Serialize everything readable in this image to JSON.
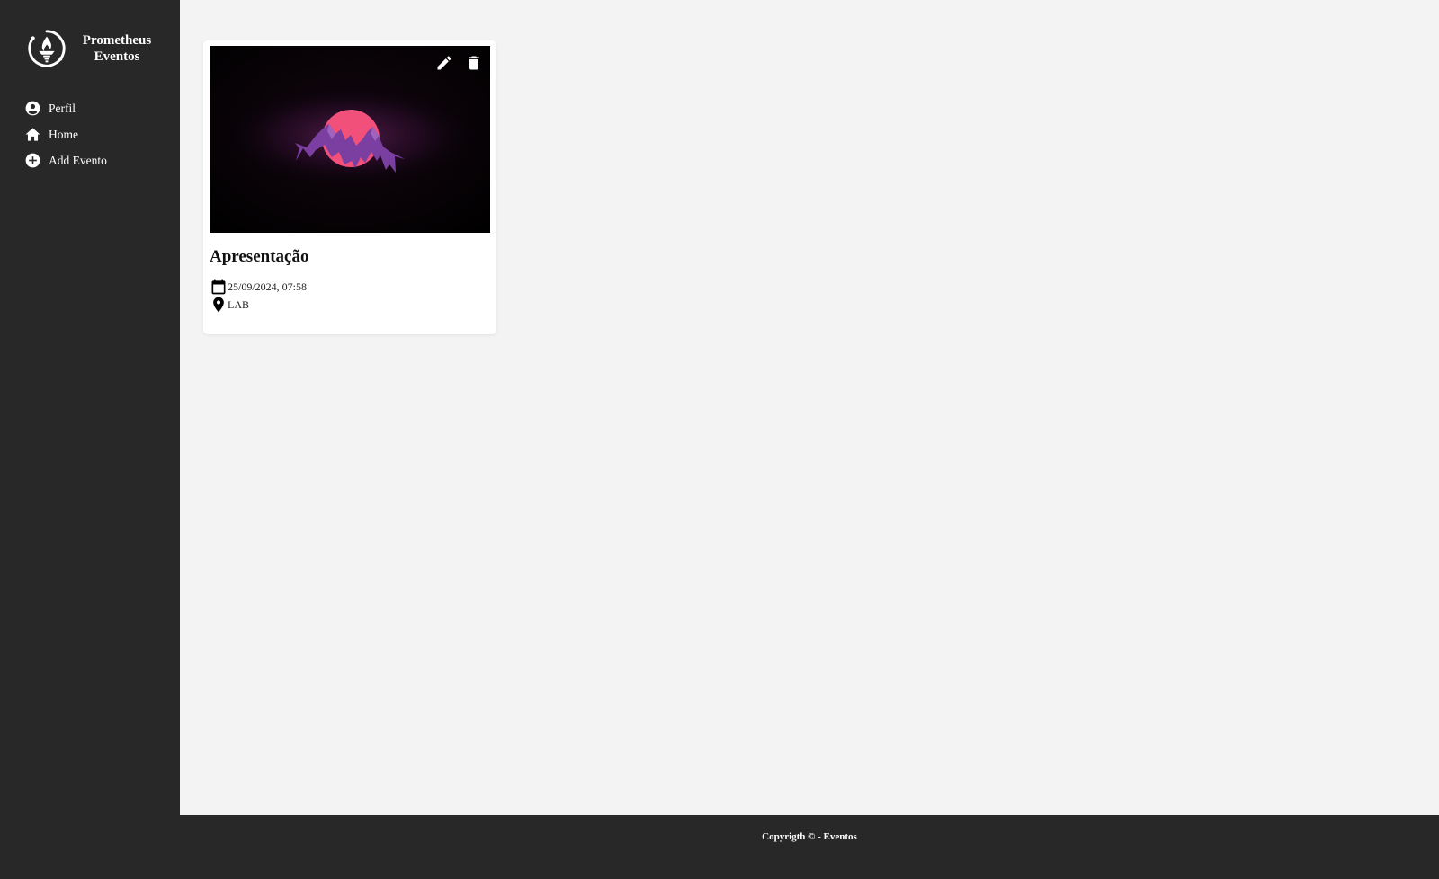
{
  "brand": {
    "name_line1": "Prometheus",
    "name_line2": "Eventos",
    "logo_icon": "torch-logo-icon"
  },
  "sidebar": {
    "items": [
      {
        "label": "Perfil",
        "icon": "account-circle-icon"
      },
      {
        "label": "Home",
        "icon": "home-icon"
      },
      {
        "label": "Add Evento",
        "icon": "add-circle-icon"
      }
    ]
  },
  "events": [
    {
      "title": "Apresentação",
      "datetime": "25/09/2024, 07:58",
      "location": "LAB",
      "date_icon": "calendar-icon",
      "location_icon": "location-pin-icon",
      "actions": {
        "edit_icon": "edit-icon",
        "delete_icon": "delete-icon"
      }
    }
  ],
  "footer": {
    "text": "Copyrigth © - Eventos"
  },
  "colors": {
    "sidebar_bg": "#282828",
    "main_bg": "#f3f3f3",
    "card_bg": "#ffffff",
    "sun": "#f0507a",
    "mountains": "#7a3fa0"
  }
}
